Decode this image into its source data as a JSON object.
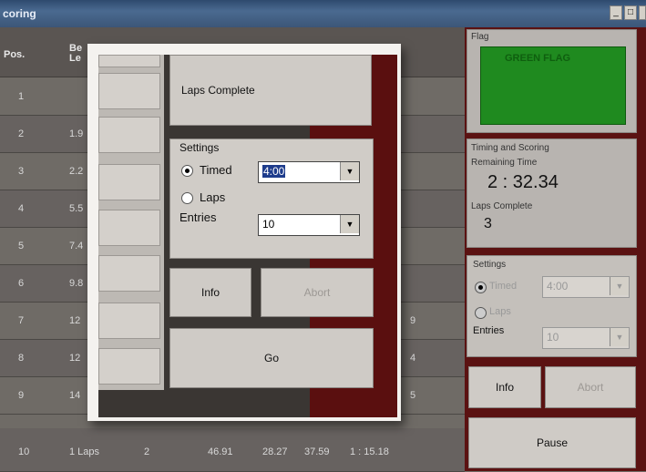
{
  "window": {
    "title": "coring",
    "minimize_icon": "minimize-icon",
    "restore_icon": "restore-icon"
  },
  "table": {
    "headers": [
      "Pos.",
      "Be Le"
    ],
    "rows": [
      {
        "pos": "1",
        "c2": "",
        "c3": "",
        "c4": "",
        "c5": "",
        "c6": "",
        "c7": ""
      },
      {
        "pos": "2",
        "c2": "1.9",
        "c3": "",
        "c4": "",
        "c5": "",
        "c6": "",
        "c7": ""
      },
      {
        "pos": "3",
        "c2": "2.2",
        "c3": "",
        "c4": "",
        "c5": "",
        "c6": "",
        "c7": ""
      },
      {
        "pos": "4",
        "c2": "5.5",
        "c3": "",
        "c4": "",
        "c5": "",
        "c6": "",
        "c7": ""
      },
      {
        "pos": "5",
        "c2": "7.4",
        "c3": "",
        "c4": "",
        "c5": "",
        "c6": "",
        "c7": ""
      },
      {
        "pos": "6",
        "c2": "9.8",
        "c3": "",
        "c4": "",
        "c5": "",
        "c6": "",
        "c7": ""
      },
      {
        "pos": "7",
        "c2": "12",
        "c3": "",
        "c4": "",
        "c5": "",
        "c6": "",
        "c7": "9"
      },
      {
        "pos": "8",
        "c2": "12",
        "c3": "",
        "c4": "",
        "c5": "",
        "c6": "",
        "c7": "4"
      },
      {
        "pos": "9",
        "c2": "14",
        "c3": "",
        "c4": "",
        "c5": "",
        "c6": "",
        "c7": "5"
      },
      {
        "pos": "10",
        "c2": "1 Laps",
        "c3": "2",
        "c4": "46.91",
        "c5": "28.27",
        "c6": "37.59",
        "c7": "1 : 15.18"
      }
    ]
  },
  "flag": {
    "legend": "Flag",
    "text": "GREEN FLAG",
    "color": "#1f8a1f"
  },
  "timing": {
    "legend": "Timing and Scoring",
    "remaining_label": "Remaining Time",
    "remaining_value": "2 : 32.34",
    "laps_label": "Laps Complete",
    "laps_value": "3"
  },
  "settings_right": {
    "legend": "Settings",
    "timed_label": "Timed",
    "timed_value": "4:00",
    "laps_label": "Laps",
    "entries_label": "Entries",
    "entries_value": "10"
  },
  "right_buttons": {
    "info": "Info",
    "abort": "Abort",
    "pause": "Pause"
  },
  "dialog": {
    "laps_complete": "Laps Complete",
    "settings_legend": "Settings",
    "timed_label": "Timed",
    "timed_value": "4:00",
    "laps_label": "Laps",
    "entries_label": "Entries",
    "entries_value": "10",
    "info": "Info",
    "abort": "Abort",
    "go": "Go"
  }
}
